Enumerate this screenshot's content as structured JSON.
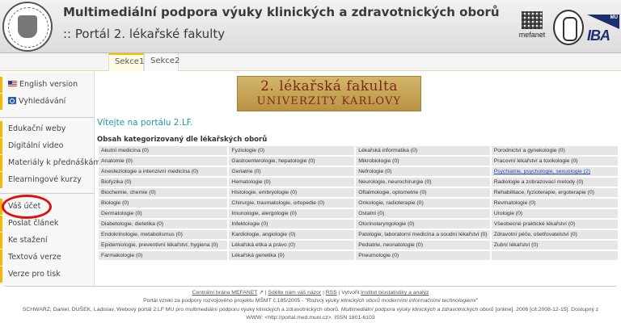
{
  "header": {
    "title_line1": "Multimediální podpora výuky klinických a zdravotnických oborů",
    "title_line2": ":: Portál 2. lékařské fakulty",
    "logos": {
      "mefanet": "mefanet",
      "iba_mu": "MU",
      "iba": "IBA"
    }
  },
  "tabs": [
    {
      "label": "Sekce1",
      "active": true
    },
    {
      "label": "Sekce2",
      "active": false
    }
  ],
  "sidebar": {
    "group1": [
      {
        "label": "English version",
        "icon": "uk-flag-icon"
      },
      {
        "label": "Vyhledávání",
        "icon": "search-icon"
      }
    ],
    "group2": [
      {
        "label": "Edukační weby"
      },
      {
        "label": "Digitální video"
      },
      {
        "label": "Materiály k přednáškám"
      },
      {
        "label": "Elearningové kurzy"
      }
    ],
    "group3": [
      {
        "label": "Váš účet"
      },
      {
        "label": "Poslat článek"
      },
      {
        "label": "Ke stažení"
      },
      {
        "label": "Textová verze"
      },
      {
        "label": "Verze pro tisk"
      }
    ],
    "highlight_color": "#e01010",
    "accent_color": "#f5b800"
  },
  "banner": {
    "line1": "2. lékařská fakulta",
    "line2": "UNIVERZITY KARLOVY"
  },
  "main": {
    "welcome": "Vítejte na portálu 2.LF.",
    "content_heading": "Obsah kategorizovaný dle lékařských oborů",
    "rows": [
      [
        "Akutní medicína (0)",
        "Fyziologie (0)",
        "Lékařská informatika (0)",
        "Porodnictví a gynekologie (0)"
      ],
      [
        "Anatomie (0)",
        "Gastroenterologie, hepatologie (0)",
        "Mikrobiologie (0)",
        "Pracovní lékařství a toxikologie (0)"
      ],
      [
        "Anesteziologie a intenzivní medicína (0)",
        "Geriatrie (0)",
        "Nefrologie (0)",
        "Psychiatrie, psychologie, sexuologie (2)"
      ],
      [
        "Biofyzika (0)",
        "Hematologie (0)",
        "Neurologie, neurochirurgie (0)",
        "Radiologie a zobrazovací metody (0)"
      ],
      [
        "Biochemie, chemie (0)",
        "Histologie, embryologie (0)",
        "Oftalmologie, optometrie (0)",
        "Rehabilitace, fyzioterapie, ergoterapie (0)"
      ],
      [
        "Biologie (0)",
        "Chirurgie, traumatologie, ortopedie (0)",
        "Onkologie, radioterapie (0)",
        "Revmatologie (0)"
      ],
      [
        "Dermatologie (0)",
        "Imunologie, alergologie (0)",
        "Ostatní (0)",
        "Urologie (0)"
      ],
      [
        "Diabetologie, dietetika (0)",
        "Infektologie (0)",
        "Otorinolaryngologie (0)",
        "Všeobecné praktické lékařství (0)"
      ],
      [
        "Endokrinologie, metabolismus (0)",
        "Kardiologie, angiologie (0)",
        "Patologie, laboratorní medicína a soudní lékařství (0)",
        "Zdravotní péče, ošetřovatelství (0)"
      ],
      [
        "Epidemiologie, preventivní lékařství, hygiena (0)",
        "Lékařská etika a právo (0)",
        "Pediatrie, neonatologie (0)",
        "Zubní lékařství (0)"
      ],
      [
        "Farmakologie (0)",
        "Lékařská genetika (0)",
        "Pneumologie (0)",
        ""
      ]
    ],
    "linked_cell": "Psychiatrie, psychologie, sexuologie (2)"
  },
  "footer": {
    "links": [
      "Centrální brána MEFANET",
      "Sdělte nám váš názor",
      "RSS",
      "Institut biostatistiky a analýz"
    ],
    "sep": "|",
    "vytvoril": "Vytvořil",
    "line2_prefix": "Portál vznikl za podpory rozvojového projektu MŠMT č.185/2005 - ",
    "line2_italic": "\"Rozvoj výuky klinických oborů moderními informačními technologiemi\"",
    "line3_a": "SCHWARZ, Daniel, DUŠEK, Ladislav. Webový portál 2.LF MU pro multimediální podporu výuky klinických a zdravotnických oborů. ",
    "line3_italic": "Multimediální podpora výuky klinických a zdravotnických oborů",
    "line3_b": " [online]. 2006 [cit.2008-12-15]. Dostupný z",
    "line4": "WWW: <http://portal.med.muni.cz>. ISSN 1801-6103"
  }
}
